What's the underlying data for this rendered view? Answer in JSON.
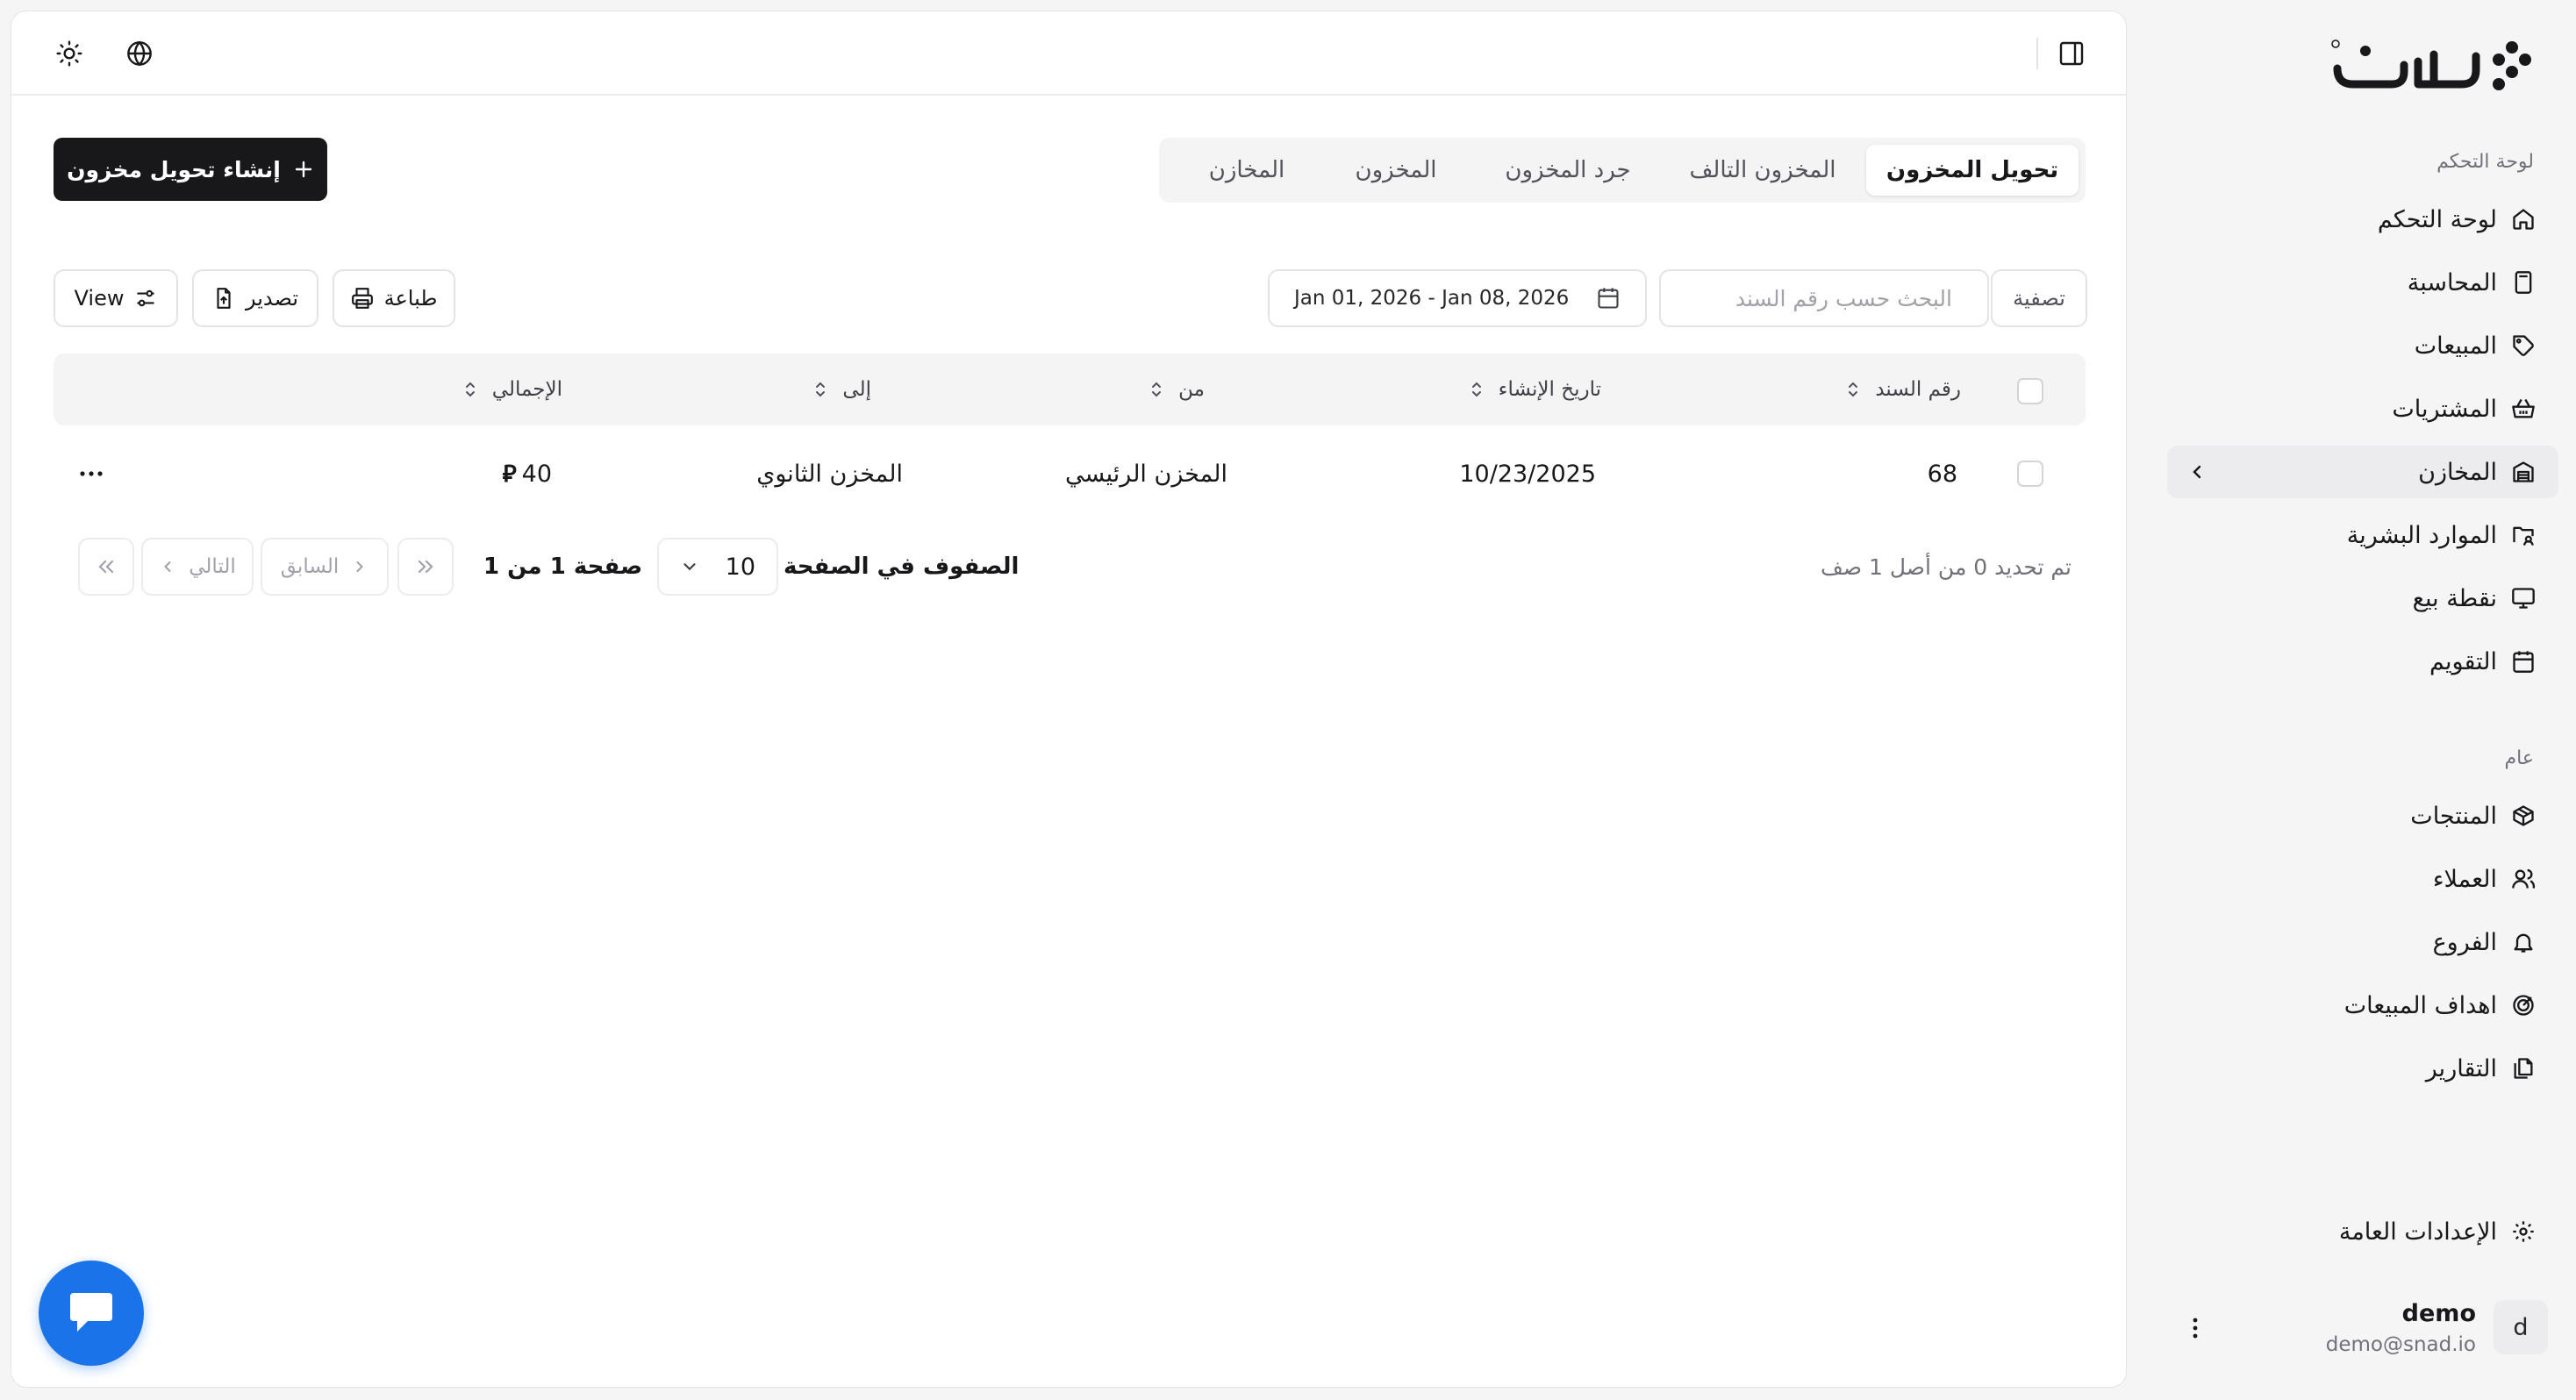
{
  "brand": {
    "logo_text": "سند",
    "accent": "#1a73e8",
    "dark": "#18181b"
  },
  "sidebar": {
    "section_dashboard": "لوحة التحكم",
    "section_general": "عام",
    "items": [
      {
        "label": "لوحة التحكم",
        "icon": "home-icon"
      },
      {
        "label": "المحاسبة",
        "icon": "calculator-icon"
      },
      {
        "label": "المبيعات",
        "icon": "tag-icon"
      },
      {
        "label": "المشتريات",
        "icon": "basket-icon"
      },
      {
        "label": "المخازن",
        "icon": "warehouse-icon",
        "active": true
      },
      {
        "label": "الموارد البشرية",
        "icon": "users-folder-icon"
      },
      {
        "label": "نقطة بيع",
        "icon": "monitor-icon"
      },
      {
        "label": "التقويم",
        "icon": "calendar-icon"
      }
    ],
    "general_items": [
      {
        "label": "المنتجات",
        "icon": "box-icon"
      },
      {
        "label": "العملاء",
        "icon": "users-icon"
      },
      {
        "label": "الفروع",
        "icon": "bell-icon"
      },
      {
        "label": "اهداف المبيعات",
        "icon": "target-icon"
      },
      {
        "label": "التقارير",
        "icon": "files-icon"
      }
    ],
    "settings": "الإعدادات العامة",
    "user": {
      "avatar": "d",
      "name": "demo",
      "email": "demo@snad.io"
    }
  },
  "header": {
    "theme_icon": "sun-icon",
    "language_icon": "globe-icon",
    "sidebar_toggle_icon": "panel-icon"
  },
  "tabs": [
    "تحويل المخزون",
    "المخزون التالف",
    "جرد المخزون",
    "المخزون",
    "المخازن"
  ],
  "create_button": "إنشاء تحويل مخزون",
  "toolbar": {
    "filter": "تصفية",
    "search_placeholder": "البحث حسب رقم السند",
    "date_range": "Jan 01, 2026 - Jan 08, 2026",
    "print": "طباعة",
    "export": "تصدير",
    "view": "View"
  },
  "table": {
    "columns": [
      "رقم السند",
      "تاريخ الإنشاء",
      "من",
      "إلى",
      "الإجمالي"
    ],
    "rows": [
      {
        "number": "68",
        "created": "10/23/2025",
        "from": "المخزن الرئيسي",
        "to": "المخزن الثانوي",
        "total": "40",
        "currency": "⃁"
      }
    ]
  },
  "pagination": {
    "selection_text": "تم تحديد 0 من أصل 1 صف",
    "rows_per_page_label": "الصفوف في الصفحة",
    "rows_per_page": "10",
    "page_text": "صفحة 1 من 1",
    "prev": "السابق",
    "next": "التالي"
  }
}
